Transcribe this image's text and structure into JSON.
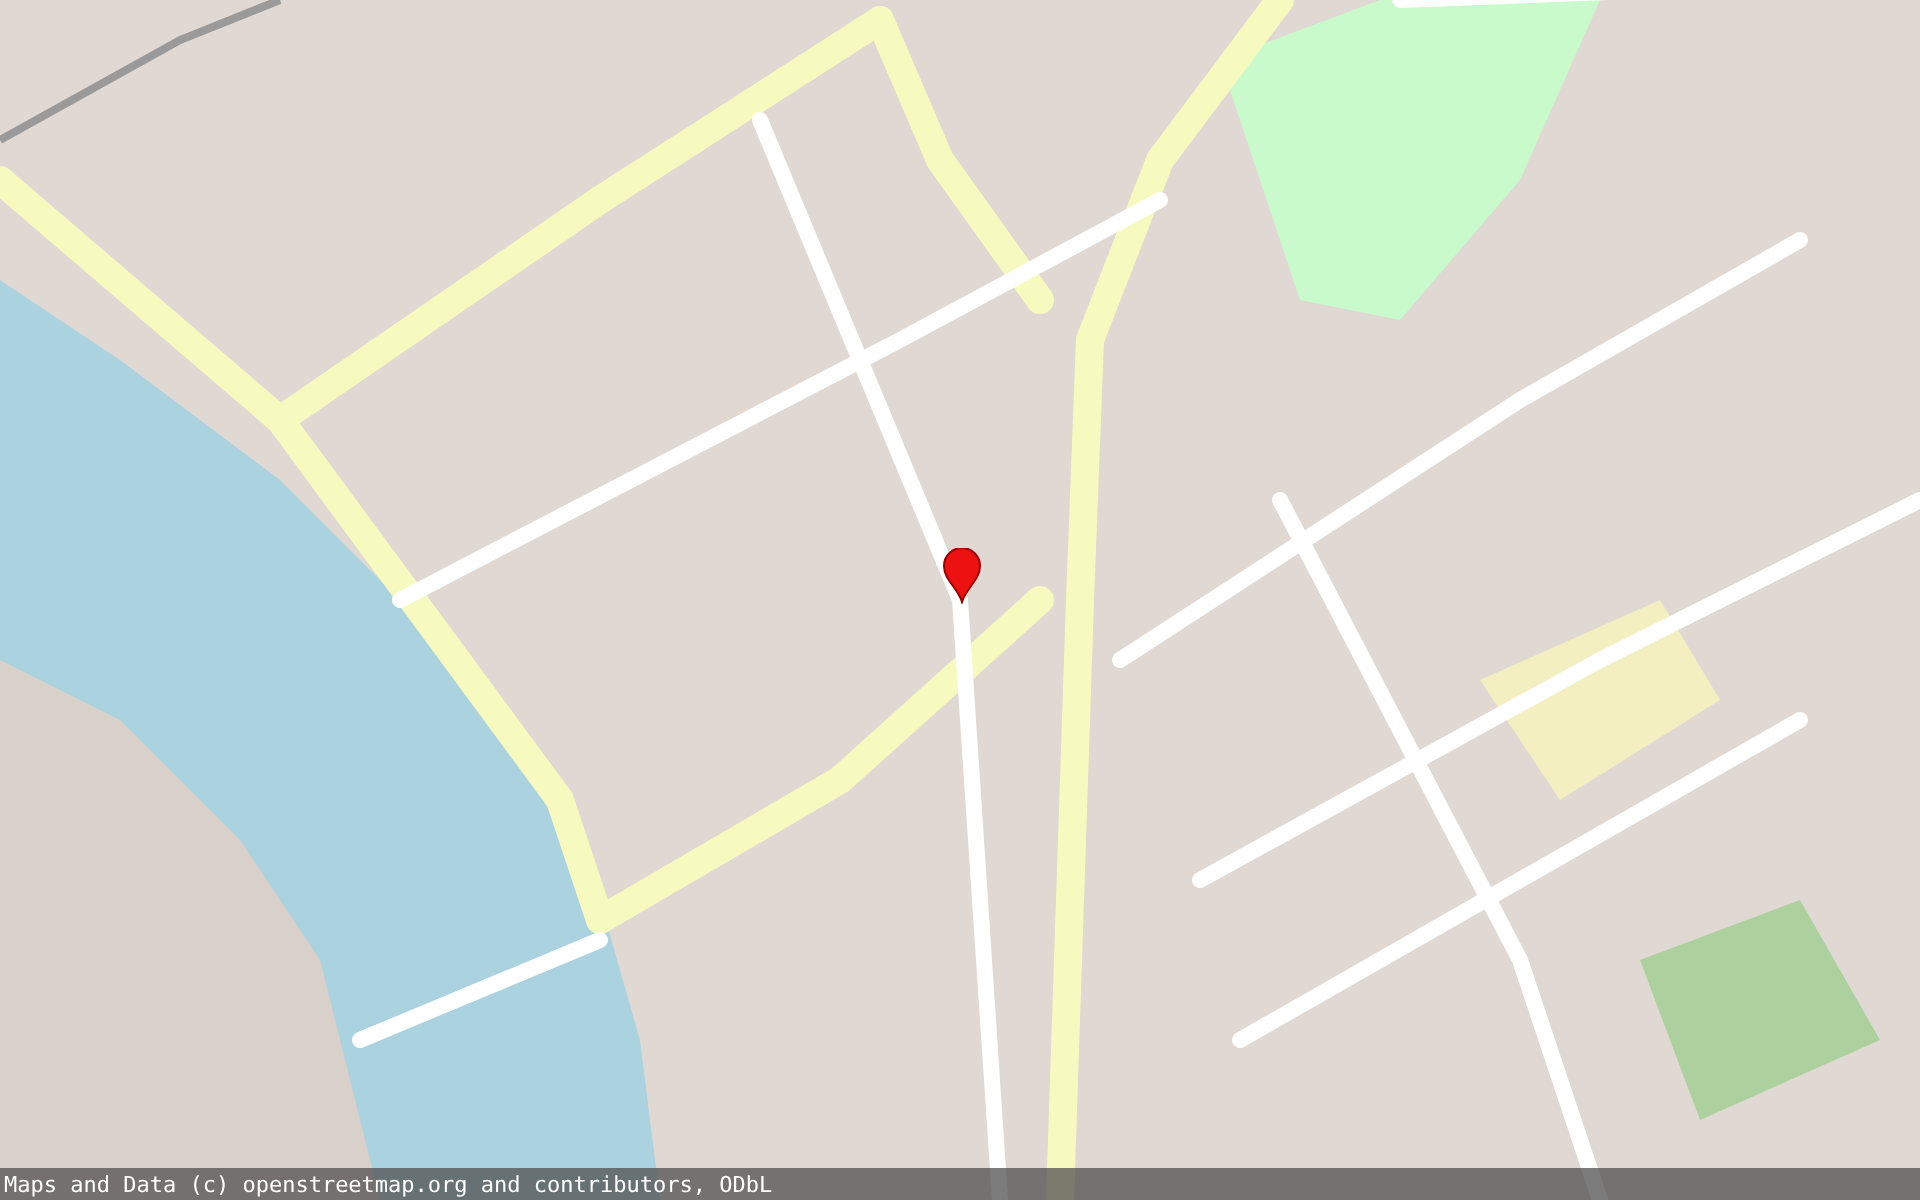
{
  "attribution": {
    "text": "Maps and Data (c) openstreetmap.org and contributors, ODbL"
  }
}
